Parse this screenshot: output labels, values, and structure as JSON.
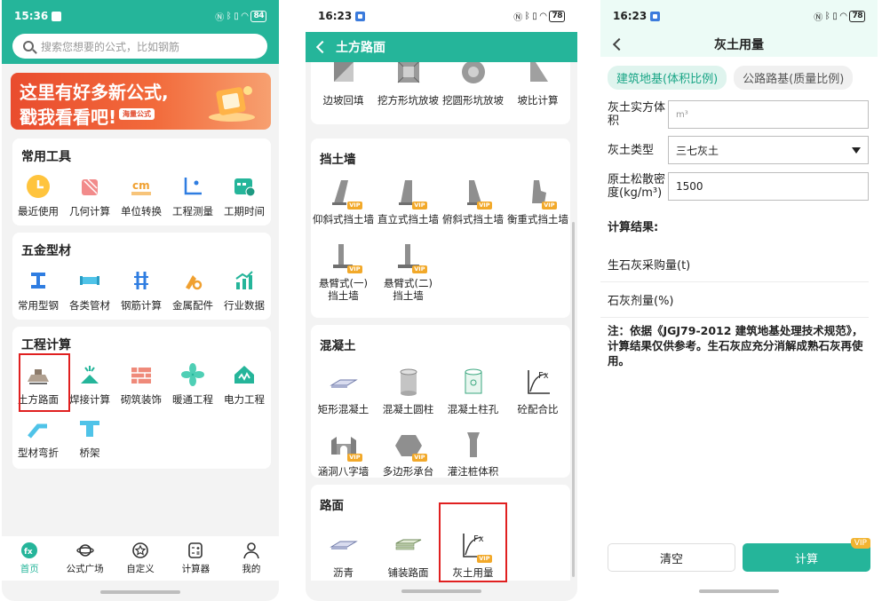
{
  "screen1": {
    "status": {
      "time": "15:36",
      "battery": "84"
    },
    "search": {
      "placeholder": "搜索您想要的公式，比如钢筋"
    },
    "banner": {
      "line1": "这里有好多新公式,",
      "line2": "戳我看看吧!",
      "tag": "海量公式"
    },
    "sections": [
      {
        "title": "常用工具",
        "items": [
          "最近使用",
          "几何计算",
          "单位转换",
          "工程测量",
          "工期时间"
        ]
      },
      {
        "title": "五金型材",
        "items": [
          "常用型钢",
          "各类管材",
          "钢筋计算",
          "金属配件",
          "行业数据"
        ]
      },
      {
        "title": "工程计算",
        "items": [
          "土方路面",
          "焊接计算",
          "砌筑装饰",
          "暖通工程",
          "电力工程",
          "型材弯折",
          "桥架"
        ]
      }
    ],
    "tabs": [
      "首页",
      "公式广场",
      "自定义",
      "计算器",
      "我的"
    ],
    "colors": {
      "accent": "#25b59a",
      "highlight": "#e02020"
    }
  },
  "screen2": {
    "status": {
      "time": "16:23",
      "battery": "78"
    },
    "title": "土方路面",
    "top_items": [
      "边坡回填",
      "挖方形坑放坡",
      "挖圆形坑放坡",
      "坡比计算"
    ],
    "sections": [
      {
        "title": "挡土墙",
        "items": [
          "仰斜式挡土墙",
          "直立式挡土墙",
          "俯斜式挡土墙",
          "衡重式挡土墙",
          "悬臂式(一)挡土墙",
          "悬臂式(二)挡土墙"
        ]
      },
      {
        "title": "混凝土",
        "items": [
          "矩形混凝土",
          "混凝土圆柱",
          "混凝土柱孔",
          "砼配合比",
          "涵洞八字墙",
          "多边形承台",
          "灌注桩体积"
        ]
      },
      {
        "title": "路面",
        "items": [
          "沥青",
          "铺装路面",
          "灰土用量"
        ]
      }
    ],
    "vip_label": "VIP",
    "fx_label": "Fx"
  },
  "screen3": {
    "status": {
      "time": "16:23",
      "battery": "78"
    },
    "title": "灰土用量",
    "toggles": [
      "建筑地基(体积比例)",
      "公路路基(质量比例)"
    ],
    "fields": {
      "f1_label": "灰土实方体积",
      "f1_placeholder": "m³",
      "f2_label": "灰土类型",
      "f2_value": "三七灰土",
      "f3_label": "原土松散密度(kg/m³)",
      "f3_value": "1500"
    },
    "result_title": "计算结果:",
    "results": [
      "生石灰采购量(t)",
      "石灰剂量(%)"
    ],
    "note": "注：依据《JGJ79-2012 建筑地基处理技术规范》，计算结果仅供参考。生石灰应充分消解成熟石灰再使用。",
    "buttons": {
      "clear": "清空",
      "calc": "计算",
      "vip": "VIP"
    }
  }
}
